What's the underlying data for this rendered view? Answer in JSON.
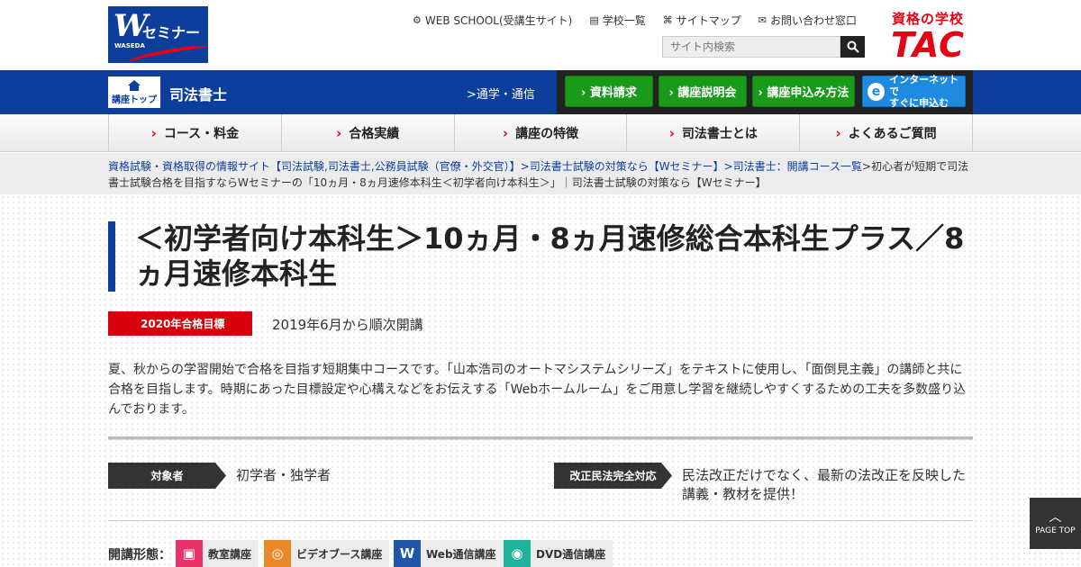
{
  "header": {
    "brand_mark": "W",
    "brand_kana": "セミナー",
    "brand_sub": "WASEDA",
    "tac_tagline": "資格の学校",
    "tac_logo": "TAC",
    "util_links": [
      {
        "label": "WEB SCHOOL(受講生サイト)",
        "icon": "gear-icon",
        "glyph": "⚙"
      },
      {
        "label": "学校一覧",
        "icon": "building-icon",
        "glyph": "▤"
      },
      {
        "label": "サイトマップ",
        "icon": "sitemap-icon",
        "glyph": "⌘"
      },
      {
        "label": "お問い合わせ窓口",
        "icon": "mail-icon",
        "glyph": "✉"
      }
    ],
    "search_placeholder": "サイト内検索"
  },
  "bluebar": {
    "course_top": "講座トップ",
    "subject": "司法書士",
    "mode_link": ">通学・通信",
    "cta": [
      {
        "label": "› 資料請求"
      },
      {
        "label": "› 講座説明会"
      },
      {
        "label": "› 講座申込み方法"
      }
    ],
    "net_line1": "インターネットで",
    "net_line2": "すぐに申込む"
  },
  "gnav": [
    {
      "label": "コース・料金"
    },
    {
      "label": "合格実績"
    },
    {
      "label": "講座の特徴"
    },
    {
      "label": "司法書士とは"
    },
    {
      "label": "よくあるご質問"
    }
  ],
  "breadcrumb": {
    "link1": "資格試験・資格取得の情報サイト【司法試験,司法書士,公務員試験（官僚・外交官）】",
    "link2": ">司法書士試験の対策なら【Wセミナー】",
    "link3": ">司法書士：開講コース一覧",
    "current": ">初心者が短期で司法書士試験合格を目指すならWセミナーの「10ヵ月・8ヵ月速修本科生＜初学者向け本科生＞」｜司法書士試験の対策なら【Wセミナー】"
  },
  "main": {
    "title": "＜初学者向け本科生＞10ヵ月・8ヵ月速修総合本科生プラス／8ヵ月速修本科生",
    "target_badge": "2020年合格目標",
    "start": "2019年6月から順次開講",
    "description": "夏、秋からの学習開始で合格を目指す短期集中コースです。「山本浩司のオートマシステムシリーズ」をテキストに使用し、「面倒見主義」の講師と共に合格を目指します。時期にあった目標設定や心構えなどをお伝えする「Webホームルーム」をご用意し学習を継続しやすくするための工夫を多数盛り込んでおります。",
    "audience_tag": "対象者",
    "audience_text": "初学者・独学者",
    "law_tag": "改正民法完全対応",
    "law_text": "民法改正だけでなく、最新の法改正を反映した講義・教材を提供！",
    "format_label": "開講形態：",
    "formats": [
      {
        "label": "教室講座",
        "color": "#e8336b",
        "icon": "classroom-icon",
        "glyph": "▣"
      },
      {
        "label": "ビデオブース講座",
        "color": "#e8892a",
        "icon": "video-booth-icon",
        "glyph": "◎"
      },
      {
        "label": "Web通信講座",
        "color": "#1f56a8",
        "icon": "web-icon",
        "glyph": "W"
      },
      {
        "label": "DVD通信講座",
        "color": "#1fb29a",
        "icon": "dvd-icon",
        "glyph": "◉"
      }
    ]
  },
  "pagetop": "PAGE TOP"
}
